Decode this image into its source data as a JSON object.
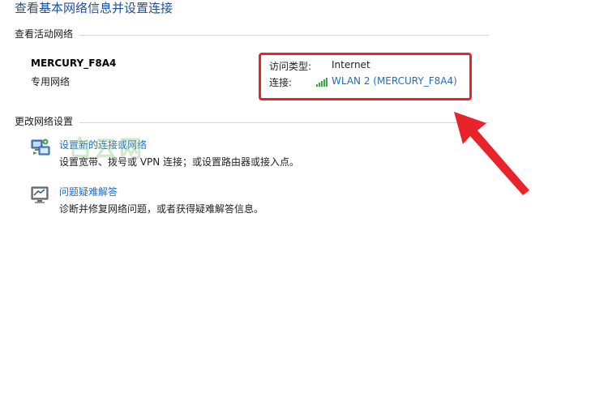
{
  "page_title": "查看基本网络信息并设置连接",
  "active_networks": {
    "header": "查看活动网络",
    "network_name": "MERCURY_F8A4",
    "network_type": "专用网络",
    "access_type_label": "访问类型:",
    "access_type_value": "Internet",
    "connection_label": "连接:",
    "connection_value": "WLAN 2 (MERCURY_F8A4)"
  },
  "change_settings": {
    "header": "更改网络设置",
    "items": [
      {
        "title": "设置新的连接或网络",
        "description": "设置宽带、拨号或 VPN 连接；或设置路由器或接入点。",
        "icon": "network-setup-icon"
      },
      {
        "title": "问题疑难解答",
        "description": "诊断并修复网络问题，或者获得疑难解答信息。",
        "icon": "troubleshoot-icon"
      }
    ]
  },
  "watermark": "白云网",
  "colors": {
    "title": "#1f4e9a",
    "link": "#1c6ec4",
    "highlight": "#e8232a",
    "arrow": "#e8232a",
    "signal": "#3fa34d"
  }
}
